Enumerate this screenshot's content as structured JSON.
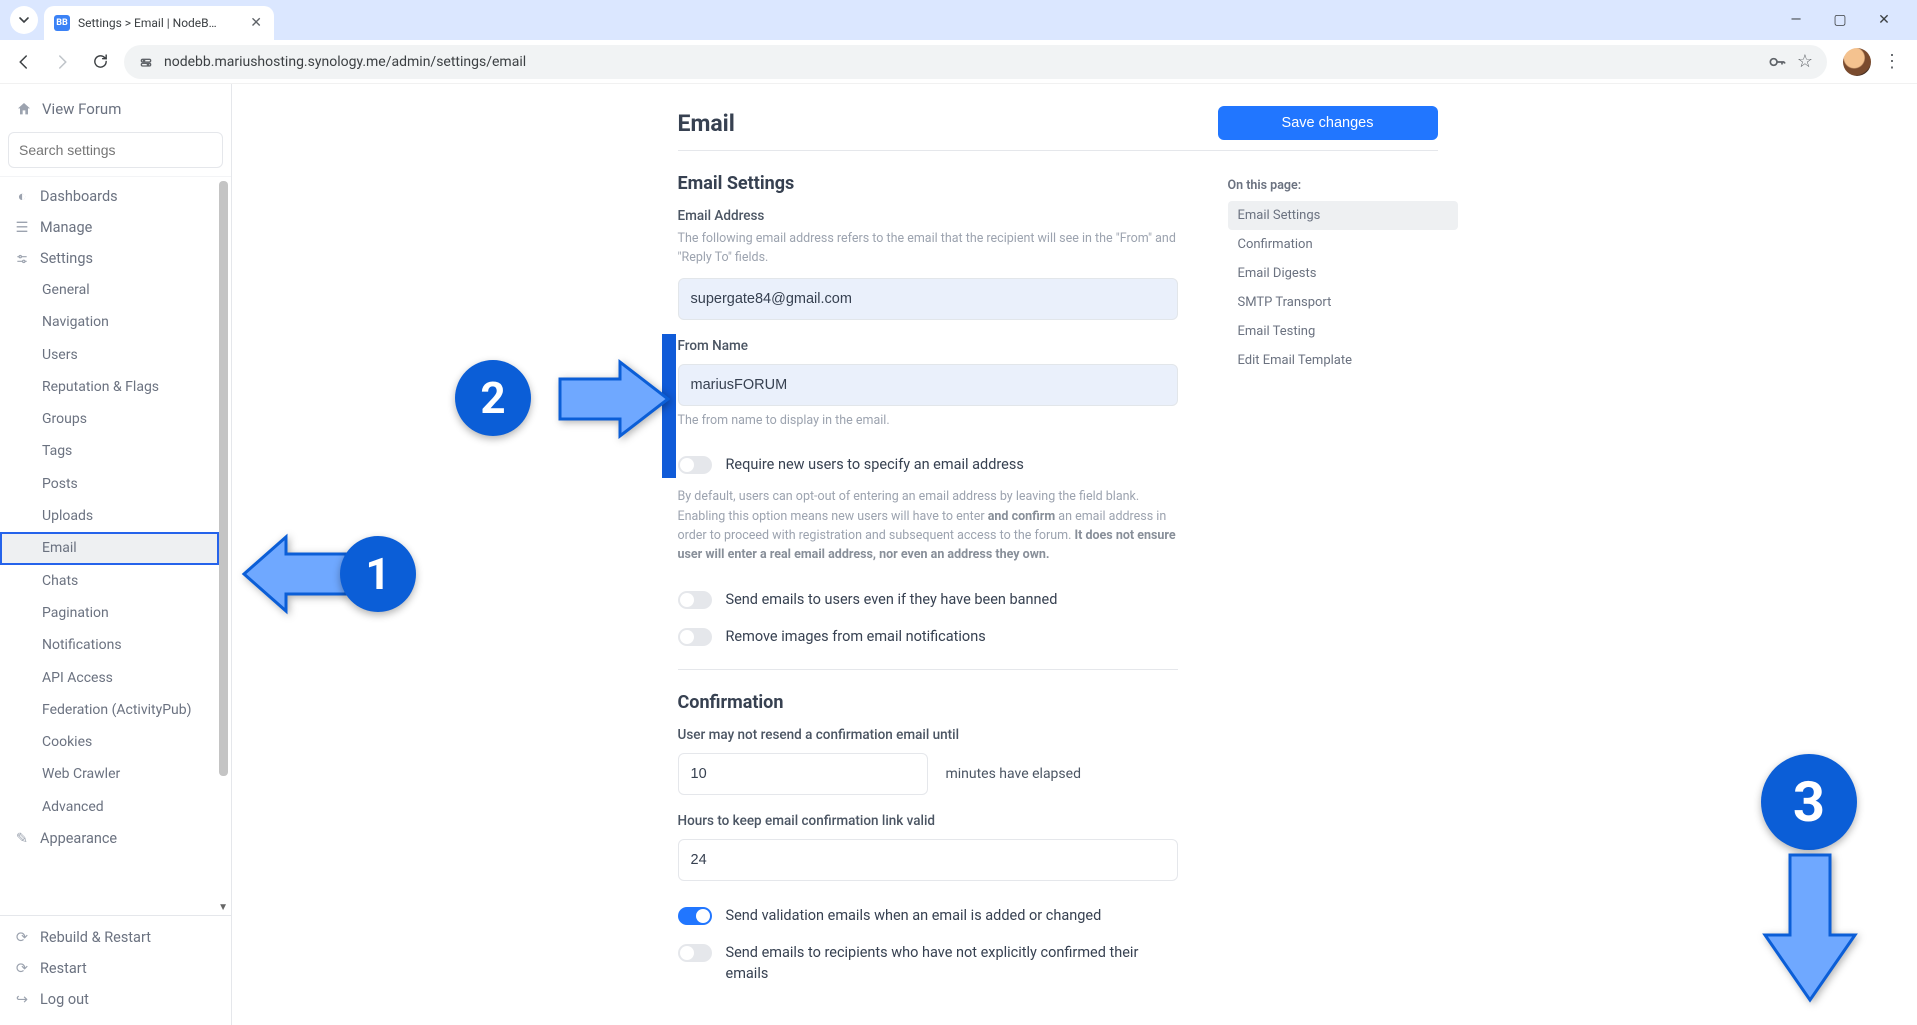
{
  "browser": {
    "tab_title": "Settings > Email | NodeB…",
    "url": "nodebb.mariushosting.synology.me/admin/settings/email"
  },
  "sidebar": {
    "view_forum": "View Forum",
    "search_placeholder": "Search settings",
    "dashboards": "Dashboards",
    "manage": "Manage",
    "settings": "Settings",
    "items": [
      "General",
      "Navigation",
      "Users",
      "Reputation & Flags",
      "Groups",
      "Tags",
      "Posts",
      "Uploads",
      "Email",
      "Chats",
      "Pagination",
      "Notifications",
      "API Access",
      "Federation (ActivityPub)",
      "Cookies",
      "Web Crawler",
      "Advanced"
    ],
    "appearance": "Appearance",
    "rebuild": "Rebuild & Restart",
    "restart": "Restart",
    "logout": "Log out"
  },
  "page": {
    "title": "Email",
    "save": "Save changes",
    "otp_title": "On this page:",
    "otp": [
      "Email Settings",
      "Confirmation",
      "Email Digests",
      "SMTP Transport",
      "Email Testing",
      "Edit Email Template"
    ]
  },
  "email_settings": {
    "heading": "Email Settings",
    "addr_label": "Email Address",
    "addr_help": "The following email address refers to the email that the recipient will see in the \"From\" and \"Reply To\" fields.",
    "addr_value": "supergate84@gmail.com",
    "from_label": "From Name",
    "from_value": "mariusFORUM",
    "from_help": "The from name to display in the email.",
    "require_label": "Require new users to specify an email address",
    "require_help_1": "By default, users can opt-out of entering an email address by leaving the field blank. Enabling this option means new users will have to enter ",
    "require_help_b1": "and confirm",
    "require_help_2": " an email address in order to proceed with registration and subsequent access to the forum. ",
    "require_help_b2": "It does not ensure user will enter a real email address, nor even an address they own.",
    "banned_label": "Send emails to users even if they have been banned",
    "remove_img_label": "Remove images from email notifications"
  },
  "confirmation": {
    "heading": "Confirmation",
    "resend_label": "User may not resend a confirmation email until",
    "resend_value": "10",
    "resend_suffix": "minutes have elapsed",
    "hours_label": "Hours to keep email confirmation link valid",
    "hours_value": "24",
    "validation_label": "Send validation emails when an email is added or changed",
    "unconfirmed_label": "Send emails to recipients who have not explicitly confirmed their emails"
  },
  "annotations": {
    "n1": "1",
    "n2": "2",
    "n3": "3"
  }
}
